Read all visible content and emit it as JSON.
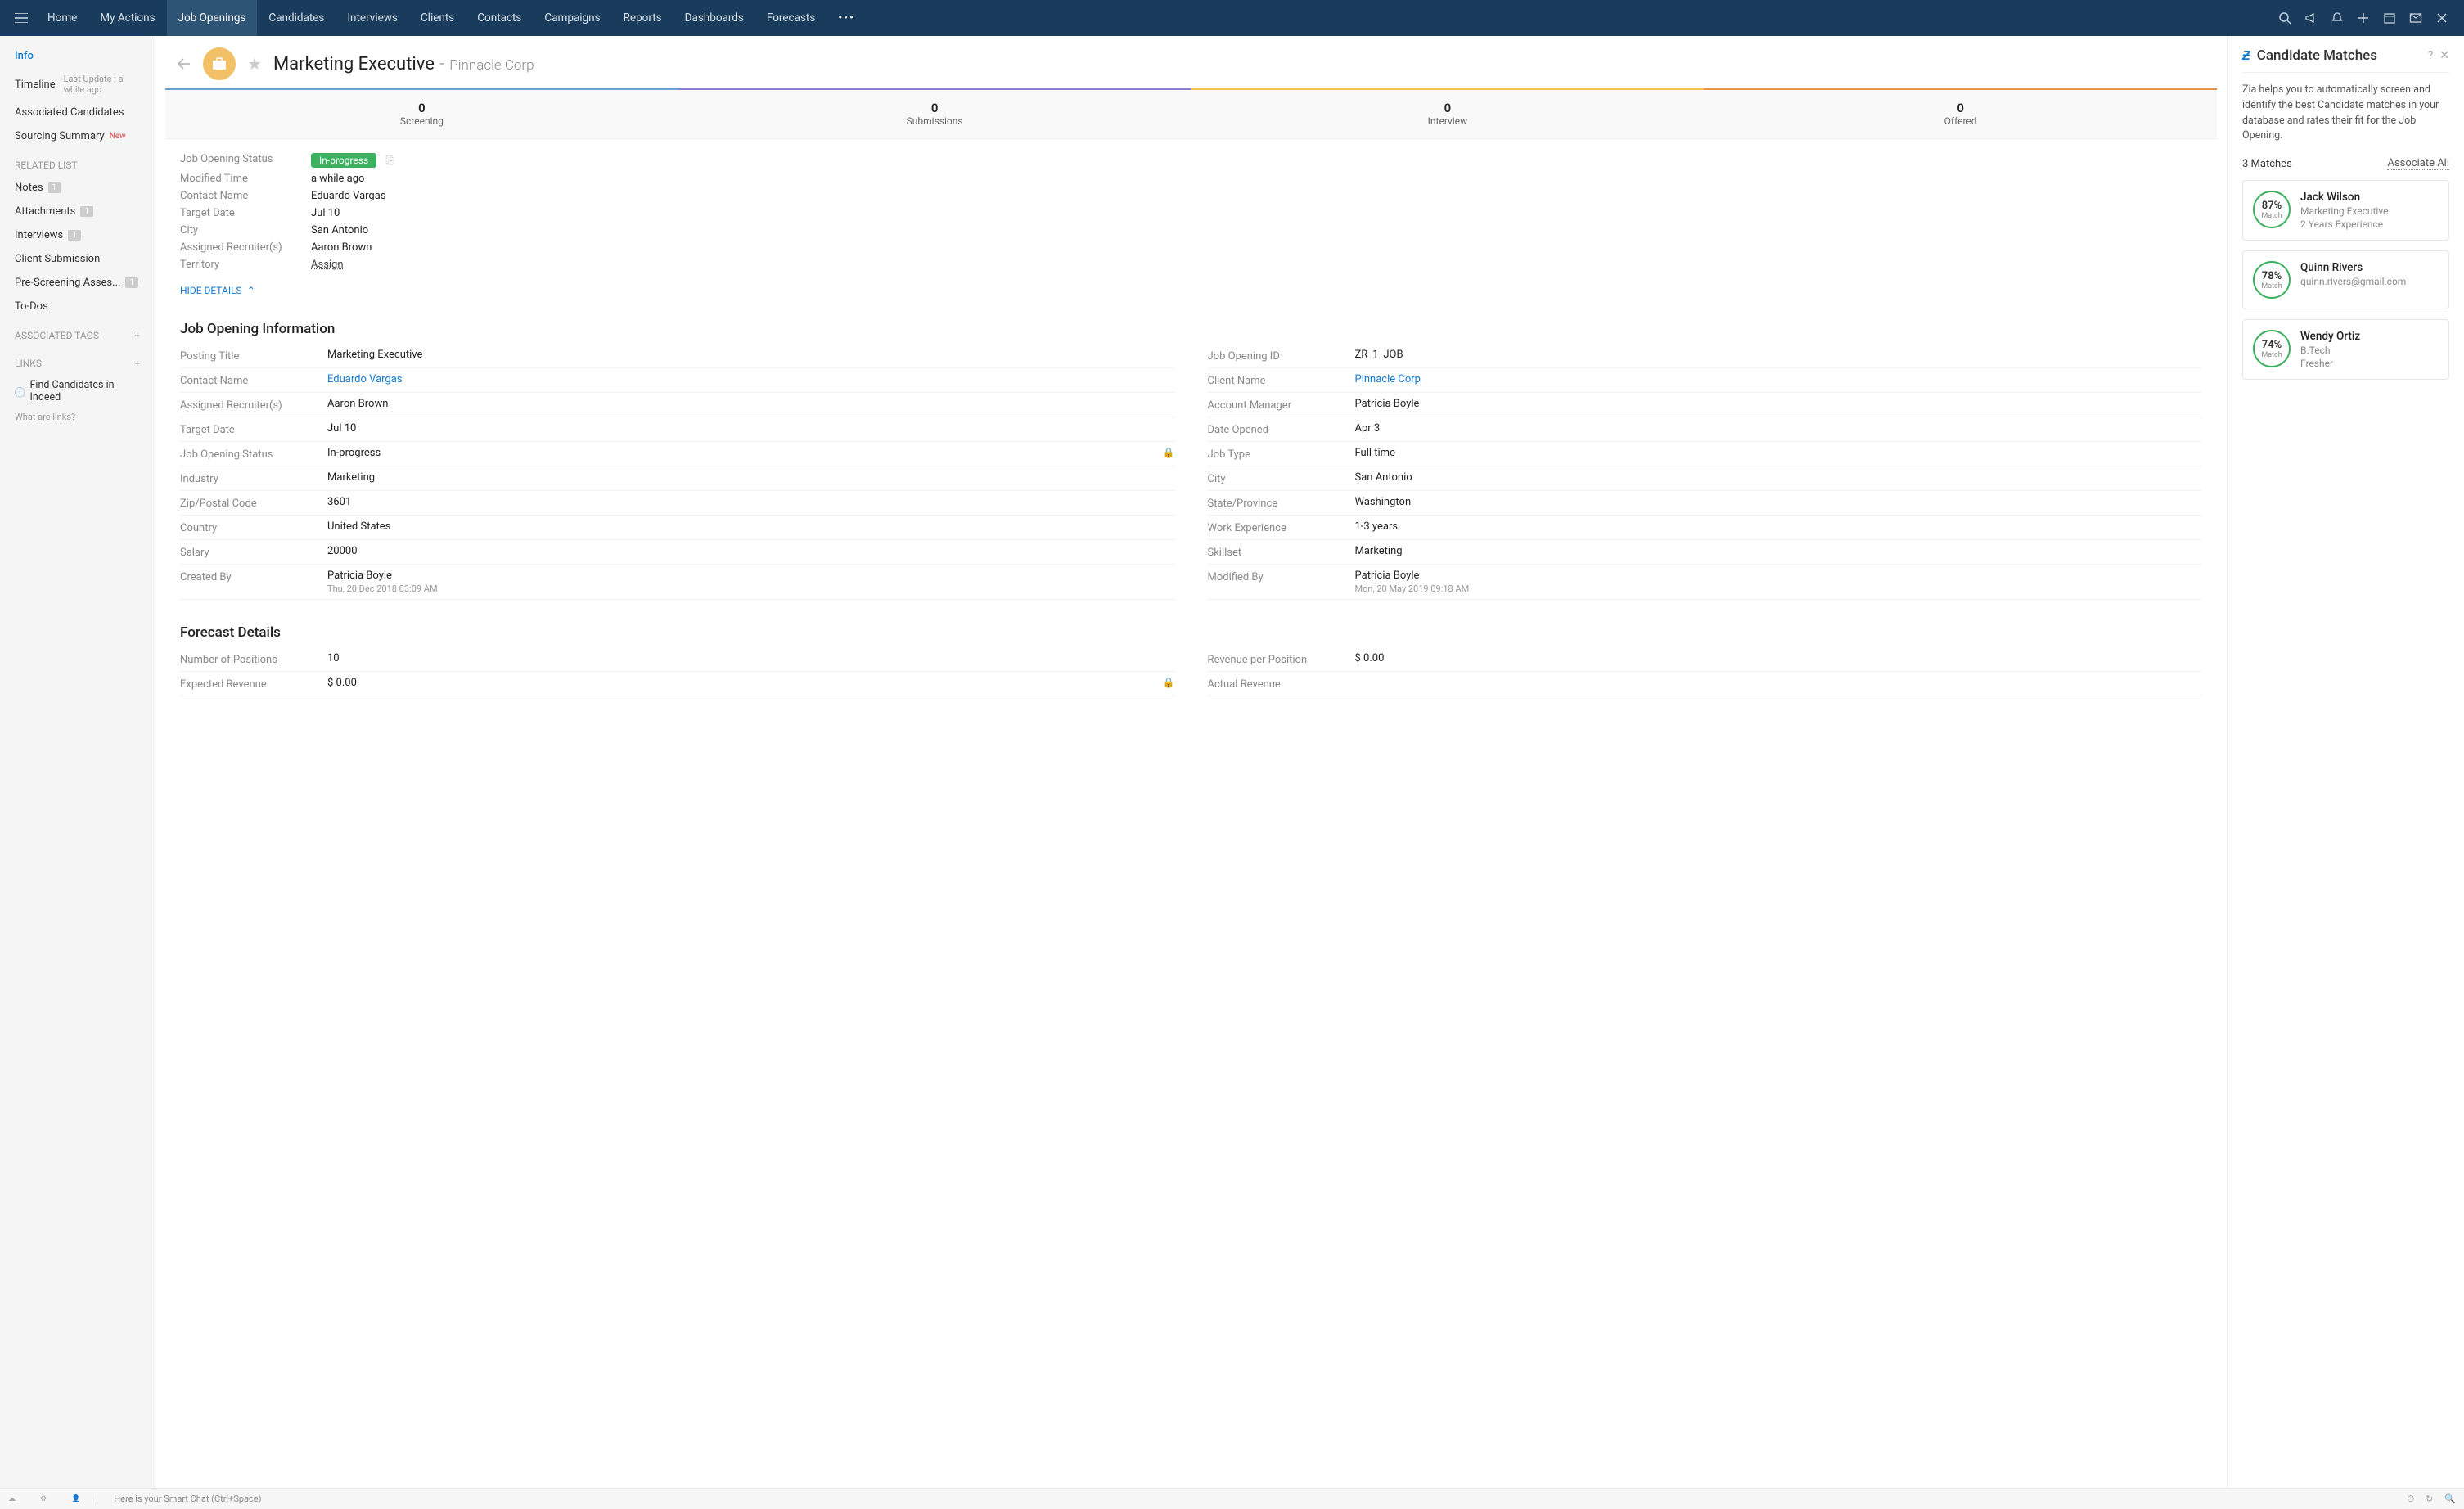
{
  "nav": {
    "tabs": [
      "Home",
      "My Actions",
      "Job Openings",
      "Candidates",
      "Interviews",
      "Clients",
      "Contacts",
      "Campaigns",
      "Reports",
      "Dashboards",
      "Forecasts"
    ],
    "activeIndex": 2
  },
  "leftbar": {
    "info": "Info",
    "timeline": "Timeline",
    "timeline_sub": "Last Update : a while ago",
    "associated_candidates": "Associated Candidates",
    "sourcing_summary": "Sourcing Summary",
    "sourcing_new": "New",
    "related_list_head": "RELATED LIST",
    "notes": "Notes",
    "attachments": "Attachments",
    "interviews": "Interviews",
    "client_submission": "Client Submission",
    "prescreening": "Pre-Screening Asses...",
    "todos": "To-Dos",
    "tags_head": "ASSOCIATED TAGS",
    "links_head": "LINKS",
    "find_candidates": "Find Candidates in Indeed",
    "what_are_links": "What are links?",
    "badge1": "1"
  },
  "header": {
    "title": "Marketing Executive",
    "company": "Pinnacle Corp"
  },
  "stages": [
    {
      "count": "0",
      "label": "Screening"
    },
    {
      "count": "0",
      "label": "Submissions"
    },
    {
      "count": "0",
      "label": "Interview"
    },
    {
      "count": "0",
      "label": "Offered"
    }
  ],
  "summary": {
    "status_label": "Job Opening Status",
    "status_value": "In-progress",
    "modified_label": "Modified Time",
    "modified_value": "a while ago",
    "contact_label": "Contact Name",
    "contact_value": "Eduardo Vargas",
    "target_label": "Target Date",
    "target_value": "Jul 10",
    "city_label": "City",
    "city_value": "San Antonio",
    "recruiter_label": "Assigned Recruiter(s)",
    "recruiter_value": "Aaron Brown",
    "territory_label": "Territory",
    "territory_value": "Assign",
    "hide_details": "HIDE DETAILS"
  },
  "jobinfo": {
    "title": "Job Opening Information",
    "left": [
      {
        "k": "Posting Title",
        "v": "Marketing Executive"
      },
      {
        "k": "Contact Name",
        "v": "Eduardo Vargas",
        "link": true
      },
      {
        "k": "Assigned Recruiter(s)",
        "v": "Aaron Brown"
      },
      {
        "k": "Target Date",
        "v": "Jul 10"
      },
      {
        "k": "Job Opening Status",
        "v": "In-progress",
        "lock": true
      },
      {
        "k": "Industry",
        "v": "Marketing"
      },
      {
        "k": "Zip/Postal Code",
        "v": "3601"
      },
      {
        "k": "Country",
        "v": "United States"
      },
      {
        "k": "Salary",
        "v": "20000"
      },
      {
        "k": "Created By",
        "v": "Patricia Boyle",
        "ts": "Thu, 20 Dec 2018 03:09 AM"
      }
    ],
    "right": [
      {
        "k": "Job Opening ID",
        "v": "ZR_1_JOB"
      },
      {
        "k": "Client Name",
        "v": "Pinnacle Corp",
        "link": true
      },
      {
        "k": "Account Manager",
        "v": "Patricia Boyle"
      },
      {
        "k": "Date Opened",
        "v": "Apr 3"
      },
      {
        "k": "Job Type",
        "v": "Full time"
      },
      {
        "k": "City",
        "v": "San Antonio"
      },
      {
        "k": "State/Province",
        "v": "Washington"
      },
      {
        "k": "Work Experience",
        "v": "1-3 years"
      },
      {
        "k": "Skillset",
        "v": "Marketing"
      },
      {
        "k": "Modified By",
        "v": "Patricia Boyle",
        "ts": "Mon, 20 May 2019 09:18 AM"
      }
    ]
  },
  "forecast": {
    "title": "Forecast Details",
    "left": [
      {
        "k": "Number of Positions",
        "v": "10"
      },
      {
        "k": "Expected Revenue",
        "v": "$ 0.00",
        "lock": true
      }
    ],
    "right": [
      {
        "k": "Revenue per Position",
        "v": "$ 0.00"
      },
      {
        "k": "Actual Revenue",
        "v": ""
      }
    ]
  },
  "rightpanel": {
    "title": "Candidate Matches",
    "desc": "Zia helps you to automatically screen and identify the best Candidate matches in your database and rates their fit for the Job Opening.",
    "count": "3 Matches",
    "associate_all": "Associate All",
    "match_label": "Match",
    "candidates": [
      {
        "pct": "87%",
        "name": "Jack Wilson",
        "meta1": "Marketing Executive",
        "meta2": "2 Years Experience"
      },
      {
        "pct": "78%",
        "name": "Quinn Rivers",
        "meta1": "quinn.rivers@gmail.com",
        "meta2": ""
      },
      {
        "pct": "74%",
        "name": "Wendy Ortiz",
        "meta1": "B.Tech",
        "meta2": "Fresher"
      }
    ]
  },
  "bottom": {
    "chat": "Here is your Smart Chat (Ctrl+Space)"
  }
}
